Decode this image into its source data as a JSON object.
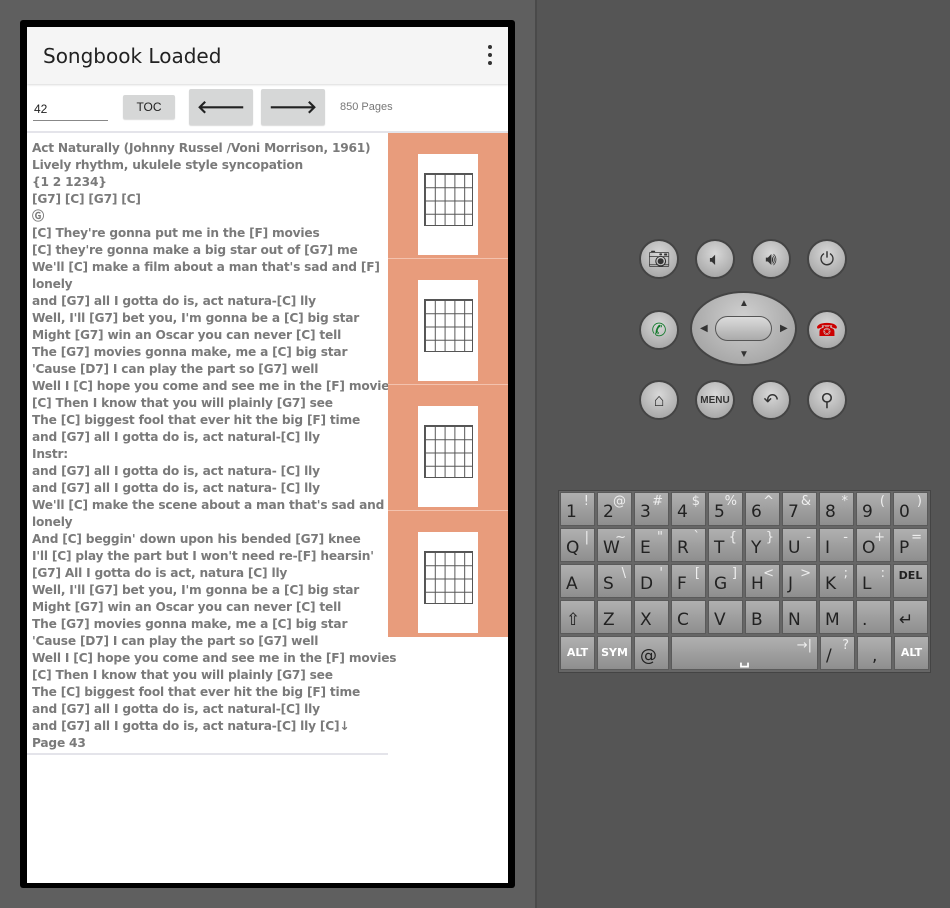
{
  "app": {
    "title": "Songbook Loaded"
  },
  "toolbar": {
    "page_value": "42",
    "toc_label": "TOC",
    "prev_label": "🡐",
    "next_label": "🡒",
    "pages_label": "850 Pages"
  },
  "lyrics": [
    "Act Naturally (Johnny Russel /Voni Morrison, 1961)",
    "Lively rhythm, ukulele style syncopation",
    "{1 2 1234}",
    "[G7] [C] [G7] [C]",
    "Ⓖ",
    "[C] They're gonna put me in the [F] movies",
    "[C] they're gonna make a big star out of [G7] me",
    "We'll [C] make a film about a man that's sad and [F]",
    "lonely",
    "and [G7] all I gotta do is, act natura-[C] lly",
    "Well, I'll [G7] bet you, I'm gonna be a [C] big star",
    "Might [G7] win an Oscar you can never [C] tell",
    "The [G7] movies gonna make, me a [C] big star",
    "'Cause [D7] I can play the part so [G7] well",
    "Well I [C] hope you come and see me in the [F] movies",
    "[C] Then I know that you will plainly [G7] see",
    "The [C] biggest fool that ever hit the big [F] time",
    "and [G7] all I gotta do is, act natural-[C] lly",
    "Instr:",
    "and [G7] all I gotta do is, act natura- [C] lly",
    "and [G7] all I gotta do is, act natura- [C] lly",
    "We'll [C] make the scene about a man that's sad and [F]",
    "lonely",
    "And [C] beggin' down upon his bended [G7] knee",
    "I'll [C] play the part but I won't need re-[F] hearsin'",
    "[G7] All I gotta do is act, natura [C] lly",
    "Well, I'll [G7] bet you, I'm gonna be a [C] big star",
    "Might [G7] win an Oscar you can never [C] tell",
    "The [G7] movies gonna make, me a [C] big star",
    "'Cause [D7] I can play the part so [G7] well",
    "Well I [C] hope you come and see me in the [F] movies",
    "[C] Then I know that you will plainly [G7] see",
    "The [C] biggest fool that ever hit the big [F] time",
    "and [G7] all I gotta do is, act natural-[C] lly",
    "and [G7] all I gotta do is, act natura-[C] lly [C]↓",
    "Page 43"
  ],
  "colors": {
    "chord_panel": "#e89c7c"
  },
  "emulator": {
    "menu_label": "MENU"
  },
  "keyboard": {
    "rows": [
      [
        [
          "1",
          "!"
        ],
        [
          "2",
          "@"
        ],
        [
          "3",
          "#"
        ],
        [
          "4",
          "$"
        ],
        [
          "5",
          "%"
        ],
        [
          "6",
          "^"
        ],
        [
          "7",
          "&"
        ],
        [
          "8",
          "*"
        ],
        [
          "9",
          "("
        ],
        [
          "0",
          ")"
        ]
      ],
      [
        [
          "Q",
          "|"
        ],
        [
          "W",
          "~"
        ],
        [
          "E",
          "\""
        ],
        [
          "R",
          "`"
        ],
        [
          "T",
          "{"
        ],
        [
          "Y",
          "}"
        ],
        [
          "U",
          "-"
        ],
        [
          "I",
          "-"
        ],
        [
          "O",
          "+"
        ],
        [
          "P",
          "="
        ]
      ],
      [
        [
          "A",
          ""
        ],
        [
          "S",
          "\\"
        ],
        [
          "D",
          "'"
        ],
        [
          "F",
          "["
        ],
        [
          "G",
          "]"
        ],
        [
          "H",
          "<"
        ],
        [
          "J",
          ">"
        ],
        [
          "K",
          ";"
        ],
        [
          "L",
          ":"
        ],
        [
          "DEL",
          ""
        ]
      ],
      [
        [
          "⇧",
          ""
        ],
        [
          "Z",
          ""
        ],
        [
          "X",
          ""
        ],
        [
          "C",
          ""
        ],
        [
          "V",
          ""
        ],
        [
          "B",
          ""
        ],
        [
          "N",
          ""
        ],
        [
          "M",
          ""
        ],
        [
          ".",
          ""
        ],
        [
          "↵",
          ""
        ]
      ]
    ],
    "bottom": {
      "alt": "ALT",
      "sym": "SYM",
      "at": "@",
      "space": "␣",
      "tab": "→|",
      "slash": "/",
      "question": "?",
      "comma": ","
    }
  }
}
